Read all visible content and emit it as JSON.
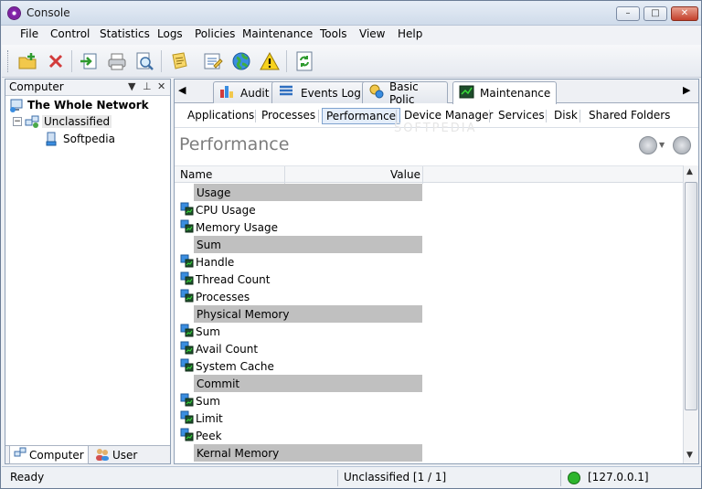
{
  "window": {
    "title": "Console",
    "controls": [
      "minimize",
      "maximize",
      "close"
    ]
  },
  "menu": [
    "File",
    "Control",
    "Statistics",
    "Logs",
    "Policies",
    "Maintenance",
    "Tools",
    "View",
    "Help"
  ],
  "toolbar": {
    "icons": [
      "new-folder-icon",
      "delete-icon",
      "import-icon",
      "print-icon",
      "print-preview-icon",
      "notes-icon",
      "report-icon",
      "globe-icon",
      "warning-icon",
      "refresh-icon"
    ]
  },
  "left_panel": {
    "title": "Computer",
    "tree": {
      "root": "The Whole Network",
      "group": "Unclassified",
      "computer": "Softpedia"
    },
    "tabs": [
      "Computer",
      "User"
    ]
  },
  "doc_tabs": [
    "Audit",
    "Events Log",
    "Basic Polic",
    "Maintenance"
  ],
  "sub_tabs": [
    "Applications",
    "Processes",
    "Performance",
    "Device Manager",
    "Services",
    "Disk",
    "Shared Folders"
  ],
  "main": {
    "title": "Performance",
    "watermark": "SOFTPEDIA",
    "columns": [
      "Name",
      "Value"
    ],
    "rows": [
      {
        "type": "group",
        "name": "Usage"
      },
      {
        "type": "item",
        "name": "CPU Usage"
      },
      {
        "type": "item",
        "name": "Memory Usage"
      },
      {
        "type": "group",
        "name": "Sum"
      },
      {
        "type": "item",
        "name": "Handle"
      },
      {
        "type": "item",
        "name": "Thread Count"
      },
      {
        "type": "item",
        "name": "Processes"
      },
      {
        "type": "group",
        "name": "Physical Memory"
      },
      {
        "type": "item",
        "name": "Sum"
      },
      {
        "type": "item",
        "name": "Avail Count"
      },
      {
        "type": "item",
        "name": "System Cache"
      },
      {
        "type": "group",
        "name": "Commit"
      },
      {
        "type": "item",
        "name": "Sum"
      },
      {
        "type": "item",
        "name": "Limit"
      },
      {
        "type": "item",
        "name": "Peek"
      },
      {
        "type": "group",
        "name": "Kernal Memory"
      }
    ]
  },
  "status": {
    "left": "Ready",
    "middle": "Unclassified [1 / 1]",
    "right": "[127.0.0.1]",
    "indicator_color": "#2db52d"
  },
  "colors": {
    "group_row_bg": "#c0c0c0",
    "accent": "#7fa3cf"
  }
}
